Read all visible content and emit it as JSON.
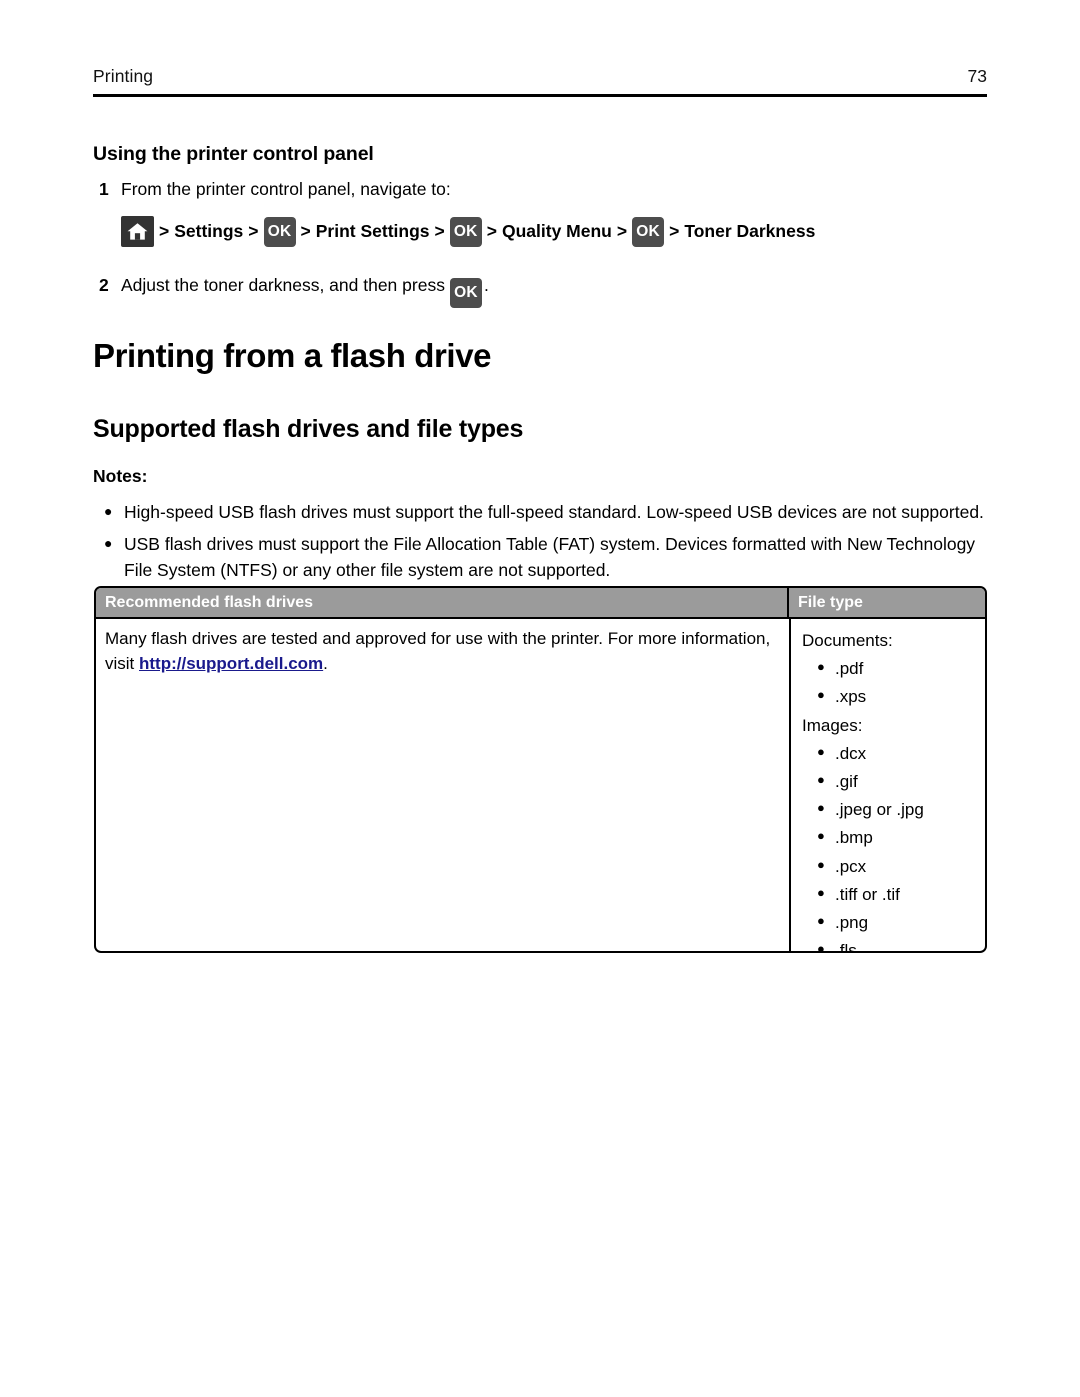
{
  "header": {
    "chapter": "Printing",
    "page_number": "73"
  },
  "sections": {
    "control_panel_heading": "Using the printer control panel",
    "h1_flash_drive": "Printing from a flash drive",
    "h2_supported": "Supported flash drives and file types"
  },
  "steps": [
    {
      "number": "1",
      "text": "From the printer control panel, navigate to:"
    },
    {
      "number": "2",
      "text_before": "Adjust the toner darkness, and then press",
      "button": "OK",
      "text_after": "."
    }
  ],
  "nav_path": {
    "home_icon": "home-icon",
    "separator": ">",
    "crumbs": [
      {
        "type": "icon",
        "icon": "home-icon",
        "label": ""
      },
      {
        "type": "text",
        "label": "Settings"
      },
      {
        "type": "button",
        "label": "OK"
      },
      {
        "type": "text",
        "label": "Print Settings"
      },
      {
        "type": "button",
        "label": "OK"
      },
      {
        "type": "text",
        "label": "Quality Menu"
      },
      {
        "type": "button",
        "label": "OK"
      },
      {
        "type": "text",
        "label": "Toner Darkness"
      }
    ]
  },
  "notes": {
    "label": "Notes:",
    "items": [
      "High-speed USB flash drives must support the full-speed standard. Low-speed USB devices are not supported.",
      "USB flash drives must support the File Allocation Table (FAT) system. Devices formatted with New Technology File System (NTFS) or any other file system are not supported."
    ]
  },
  "table": {
    "headers": {
      "col1": "Recommended flash drives",
      "col2": "File type"
    },
    "row": {
      "description_before_link": "Many flash drives are tested and approved for use with the printer. For more information, visit ",
      "link_text": "http://support.dell.com",
      "description_after_link": ".",
      "file_types": [
        {
          "group": "Documents:",
          "items": [
            ".pdf",
            ".xps"
          ]
        },
        {
          "group": "Images:",
          "items": [
            ".dcx",
            ".gif",
            ".jpeg or .jpg",
            ".bmp",
            ".pcx",
            ".tiff or .tif",
            ".png",
            ".fls"
          ]
        }
      ]
    }
  },
  "colors": {
    "header_rule": "#000000",
    "table_header_bg": "#9b9b9b",
    "table_header_text": "#ffffff",
    "link": "#1a1a8c",
    "icon_chip_bg": "#333333",
    "ok_chip_bg": "#4d4d4d"
  }
}
